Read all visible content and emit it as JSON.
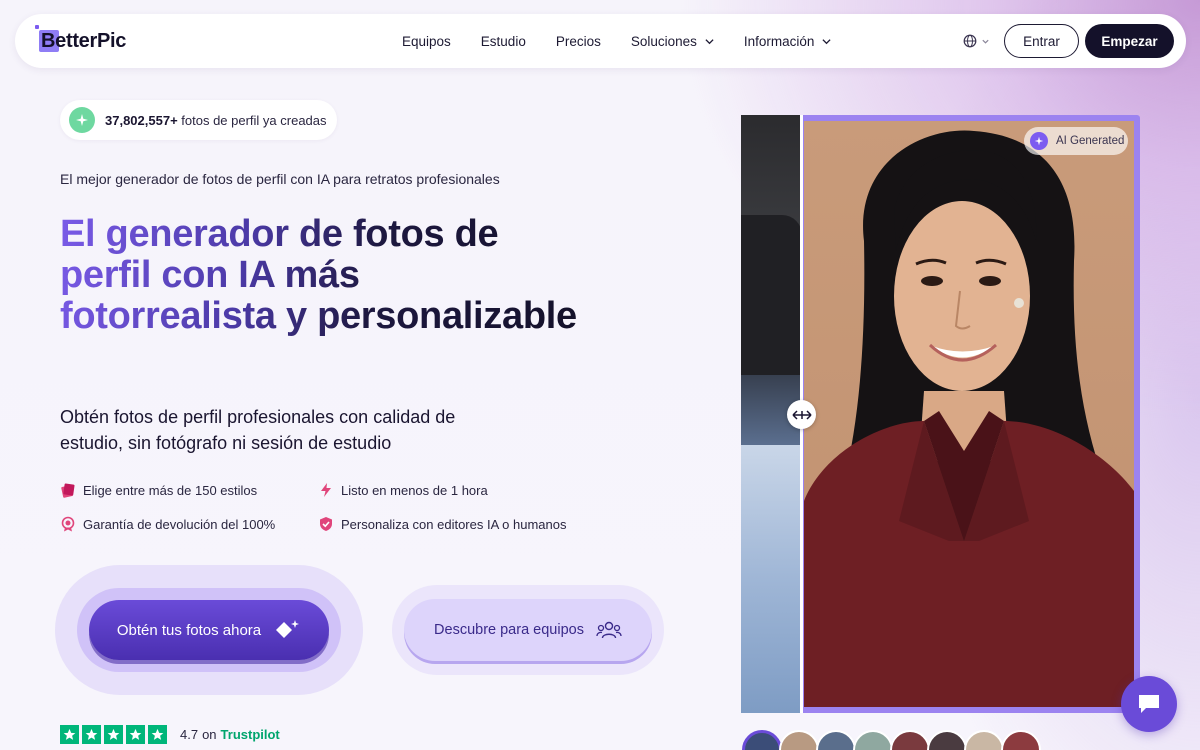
{
  "brand": {
    "name": "BetterPic"
  },
  "nav": {
    "links": [
      "Equipos",
      "Estudio",
      "Precios",
      "Soluciones",
      "Información"
    ],
    "language_icon": "globe-icon",
    "login_label": "Entrar",
    "cta_label": "Empezar"
  },
  "hero": {
    "counter_bold": "37,802,557+",
    "counter_text": " fotos de perfil ya creadas",
    "kicker": "El mejor generador de fotos de perfil con IA para retratos profesionales",
    "headline": "El generador de fotos de perfil con IA más fotorrealista y personalizable",
    "subheadline": "Obtén fotos de perfil profesionales con calidad de estudio, sin fotógrafo ni sesión de estudio",
    "features": [
      {
        "icon": "palette-icon",
        "label": "Elige entre más de 150 estilos"
      },
      {
        "icon": "lightning-icon",
        "label": "Listo en menos de 1 hora"
      },
      {
        "icon": "award-icon",
        "label": "Garantía de devolución del 100%"
      },
      {
        "icon": "shield-check-icon",
        "label": "Personaliza con editores IA o humanos"
      }
    ],
    "primary_cta": "Obtén tus fotos ahora",
    "secondary_cta": "Descubre para equipos",
    "rating": {
      "score": "4.7",
      "on": "on",
      "platform": "Trustpilot",
      "stars": 5
    }
  },
  "photo": {
    "badge": "AI Generated"
  },
  "colors": {
    "accent": "#6a4bd8",
    "dark": "#14112a",
    "trustpilot": "#00b67a"
  }
}
